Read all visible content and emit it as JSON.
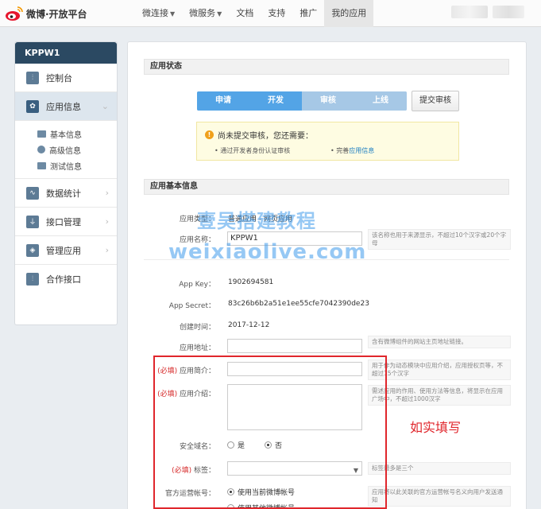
{
  "header": {
    "logo_text": "微博·开放平台",
    "nav": [
      {
        "label": "微连接",
        "dropdown": true
      },
      {
        "label": "微服务",
        "dropdown": true
      },
      {
        "label": "文档"
      },
      {
        "label": "支持"
      },
      {
        "label": "推广"
      },
      {
        "label": "我的应用",
        "active": true
      }
    ]
  },
  "sidebar": {
    "app_name": "KPPW1",
    "items": [
      {
        "label": "控制台"
      },
      {
        "label": "应用信息",
        "active": true
      },
      {
        "label": "数据统计"
      },
      {
        "label": "接口管理"
      },
      {
        "label": "管理应用"
      },
      {
        "label": "合作接口"
      }
    ],
    "subitems": [
      {
        "label": "基本信息"
      },
      {
        "label": "高级信息"
      },
      {
        "label": "测试信息"
      }
    ]
  },
  "main": {
    "status_title": "应用状态",
    "steps": [
      "申请",
      "开发",
      "审核",
      "上线"
    ],
    "submit_button": "提交审核",
    "notice": {
      "title": "尚未提交审核，您还需要：",
      "item1": "通过开发者身份认证审核",
      "item2_prefix": "完善",
      "item2_link": "应用信息"
    },
    "basic_title": "应用基本信息",
    "fields": {
      "type_label": "应用类型：",
      "type_value": "普通应用 - 网页应用",
      "name_label": "应用名称：",
      "name_value": "KPPW1",
      "name_hint": "该名称也用于来源显示，不超过10个汉字或20个字母",
      "appkey_label": "App Key：",
      "appkey_value": "1902694581",
      "secret_label": "App Secret：",
      "secret_value": "83c26b6b2a51e1ee55cfe7042390de23",
      "created_label": "创建时间：",
      "created_value": "2017-12-12",
      "url_label": "应用地址：",
      "url_hint": "含有微博组件的网站主页地址链接。",
      "brief_req": "(必填)",
      "brief_label": "应用简介：",
      "brief_hint": "用于作为动态模块中应用介绍，应用授权页等，不超过15个汉字",
      "intro_req": "(必填)",
      "intro_label": "应用介绍：",
      "intro_hint": "需述应用的作用、使用方法等信息，将显示在应用广场中，不超过1000汉字",
      "domain_label": "安全域名：",
      "domain_yes": "是",
      "domain_no": "否",
      "tag_req": "(必填)",
      "tag_label": "标签：",
      "tag_hint": "标签最多是三个",
      "official_label": "官方运营帐号：",
      "official_opt1": "使用当前微博帐号",
      "official_opt2": "使用其他微博帐号",
      "official_hint": "应用将以此关联的官方运营帐号名义向用户发送通知"
    }
  },
  "watermark": {
    "line1": "壹吴搭建教程",
    "line2": "weixiaolive.com"
  },
  "annotation": {
    "note": "如实填写"
  }
}
